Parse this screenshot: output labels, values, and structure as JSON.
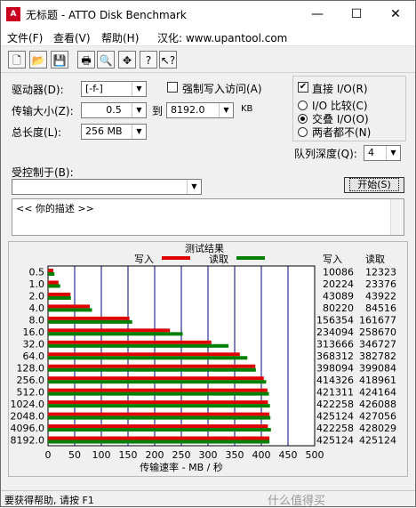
{
  "window": {
    "title": "无标题 - ATTO Disk Benchmark",
    "icon_text": "A",
    "minimize": "—",
    "maximize": "☐",
    "close": "✕"
  },
  "menu": [
    "文件(F)",
    "查看(V)",
    "帮助(H)",
    "汉化: www.upantool.com"
  ],
  "toolbar": {
    "icons": [
      "new-icon",
      "open-icon",
      "save-icon",
      "print-icon",
      "print-preview-icon",
      "move-icon",
      "help-icon",
      "context-help-icon"
    ],
    "glyphs": [
      "🗋",
      "📂",
      "💾",
      "🖶",
      "🔍",
      "✥",
      "?",
      "↖?"
    ]
  },
  "form": {
    "drive_label": "驱动器(D):",
    "drive_value": "[-f-]",
    "force_write_label": "强制写入访问(A)",
    "transfer_label": "传输大小(Z):",
    "transfer_from": "0.5",
    "to_label": "到",
    "transfer_to": "8192.0",
    "unit": "KB",
    "length_label": "总长度(L):",
    "length_value": "256 MB",
    "direct_io_label": "直接 I/O(R)",
    "direct_io_checked": true,
    "io_compare_label": "I/O 比较(C)",
    "overlap_label": "交叠 I/O(O)",
    "neither_label": "两者都不(N)",
    "queue_label": "队列深度(Q):",
    "queue_value": "4",
    "controlled_label": "受控制于(B):",
    "controlled_value": "",
    "start_button": "开始(S)",
    "description": "<<  你的描述  >>"
  },
  "chart_data": {
    "type": "bar",
    "title": "测试结果",
    "legend": [
      {
        "name": "写入",
        "color": "#e00000"
      },
      {
        "name": "读取",
        "color": "#008000"
      }
    ],
    "categories": [
      "0.5",
      "1.0",
      "2.0",
      "4.0",
      "8.0",
      "16.0",
      "32.0",
      "64.0",
      "128.0",
      "256.0",
      "512.0",
      "1024.0",
      "2048.0",
      "4096.0",
      "8192.0"
    ],
    "series": [
      {
        "name": "写入",
        "color": "#e00000",
        "values": [
          10086,
          20224,
          43089,
          80220,
          156354,
          234094,
          313666,
          368312,
          398094,
          414326,
          421311,
          422258,
          425124,
          422258,
          425124
        ]
      },
      {
        "name": "读取",
        "color": "#008000",
        "values": [
          12323,
          23376,
          43922,
          84516,
          161677,
          258670,
          346727,
          382782,
          399084,
          418961,
          424164,
          426088,
          427056,
          428029,
          425124
        ]
      }
    ],
    "xlabel": "传输速率 - MB / 秒",
    "xticks": [
      0,
      50,
      100,
      150,
      200,
      250,
      300,
      350,
      400,
      450,
      500
    ],
    "xlim": [
      0,
      500
    ],
    "value_units": "KB/s",
    "table_headers": [
      "写入",
      "读取"
    ]
  },
  "status": "要获得帮助, 请按 F1",
  "watermark": "什么值得买"
}
